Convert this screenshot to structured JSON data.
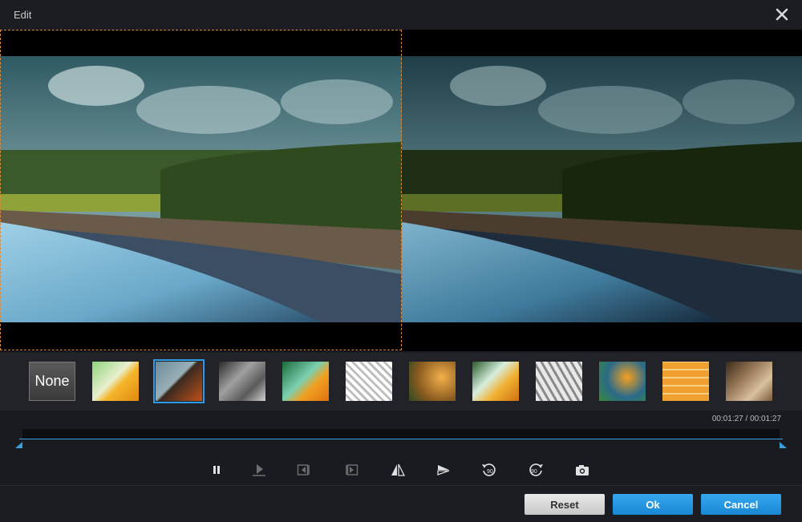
{
  "window": {
    "title": "Edit"
  },
  "filters": [
    {
      "label": "None"
    },
    {
      "label": ""
    },
    {
      "label": ""
    },
    {
      "label": ""
    },
    {
      "label": ""
    },
    {
      "label": ""
    },
    {
      "label": ""
    },
    {
      "label": ""
    },
    {
      "label": ""
    },
    {
      "label": ""
    },
    {
      "label": ""
    },
    {
      "label": ""
    }
  ],
  "selected_filter_index": 2,
  "timeline": {
    "timecode": "00:01:27 / 00:01:27",
    "progress": 1.0
  },
  "controls": [
    "pause-icon",
    "play-icon",
    "step-back-icon",
    "step-forward-icon",
    "flip-horizontal-icon",
    "flip-vertical-icon",
    "rotate-left-90-icon",
    "rotate-right-90-icon",
    "snapshot-icon"
  ],
  "rotate_labels": {
    "left": "90",
    "right": "90"
  },
  "footer": {
    "reset": "Reset",
    "ok": "Ok",
    "cancel": "Cancel"
  },
  "colors": {
    "accent": "#1f93e0",
    "crop_frame": "#d98a3a"
  }
}
